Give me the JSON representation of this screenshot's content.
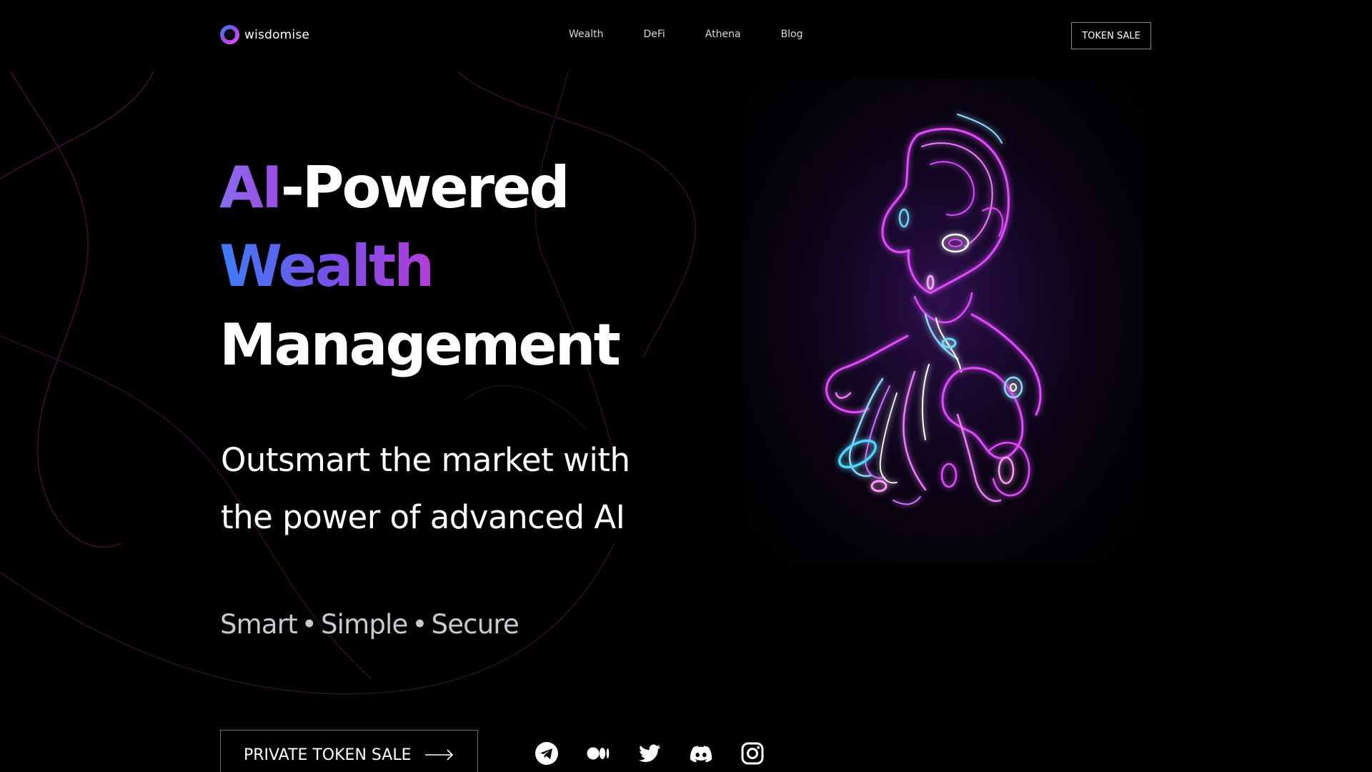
{
  "brand": {
    "name": "wisdomise",
    "logo_icon": "wisdomise-ring-logo"
  },
  "nav": {
    "items": [
      {
        "label": "Wealth"
      },
      {
        "label": "DeFi"
      },
      {
        "label": "Athena"
      },
      {
        "label": "Blog"
      }
    ],
    "token_button": "TOKEN SALE"
  },
  "hero": {
    "title_ai": "AI",
    "title_rest": "-Powered",
    "title_wealth": "Wealth",
    "title_management": "Management",
    "subtitle_line1": "Outsmart the market with",
    "subtitle_line2": "the power of advanced AI",
    "tagline": {
      "smart": "Smart",
      "simple": "Simple",
      "secure": "Secure",
      "separator": "•"
    },
    "cta_label": "PRIVATE TOKEN SALE",
    "cta_icon": "arrow-right-icon"
  },
  "socials": [
    {
      "icon": "telegram-icon"
    },
    {
      "icon": "medium-icon"
    },
    {
      "icon": "twitter-icon"
    },
    {
      "icon": "discord-icon"
    },
    {
      "icon": "instagram-icon"
    }
  ],
  "colors": {
    "background": "#000000",
    "gradient_blue": "#3d7cf5",
    "gradient_violet": "#7a4fe6",
    "gradient_magenta": "#b23ed6",
    "neon_pink": "#e14bff",
    "neon_cyan": "#4fd6ff"
  },
  "art": {
    "subject": "neon contour-line human bust"
  }
}
